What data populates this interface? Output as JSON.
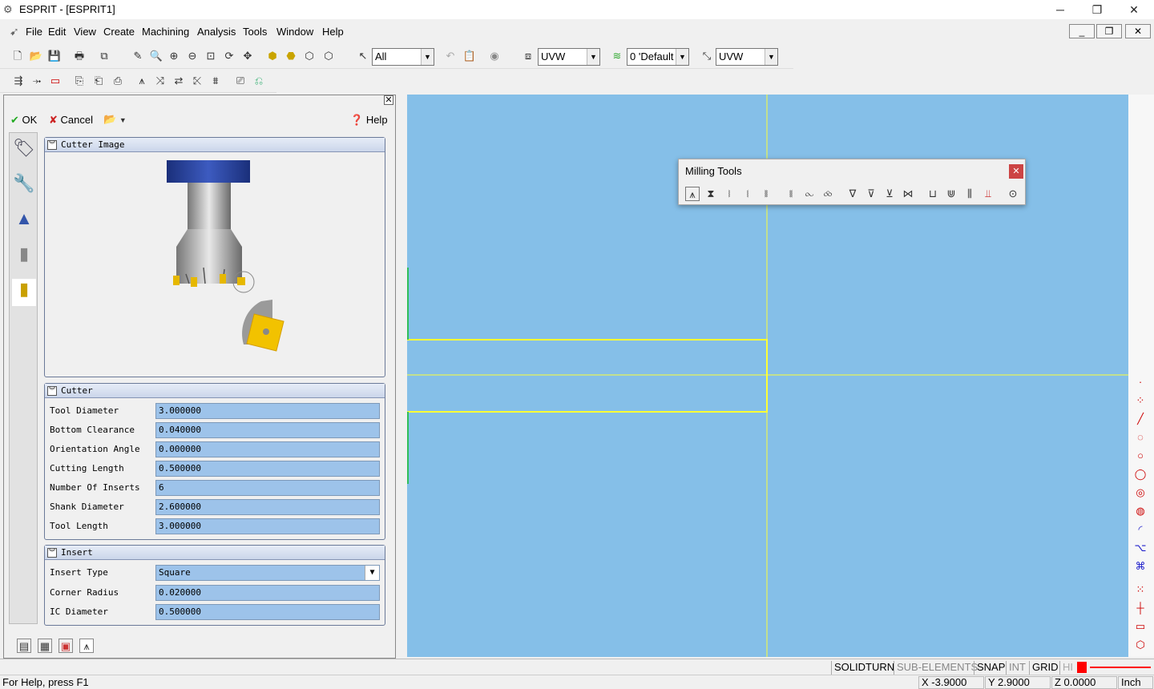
{
  "window": {
    "title": "ESPRIT - [ESPRIT1]"
  },
  "menu": [
    "File",
    "Edit",
    "View",
    "Create",
    "Machining",
    "Analysis",
    "Tools",
    "Window",
    "Help"
  ],
  "toolbar": {
    "filter_select": "All",
    "plane_select_1": "UVW",
    "layer_select": "0 'Default",
    "plane_select_2": "UVW"
  },
  "dialog": {
    "ok_label": "OK",
    "cancel_label": "Cancel",
    "help_label": "Help",
    "cutter_image_title": "Cutter Image",
    "cutter_title": "Cutter",
    "cutter_fields": [
      {
        "label": "Tool Diameter",
        "value": "3.000000"
      },
      {
        "label": "Bottom Clearance",
        "value": "0.040000"
      },
      {
        "label": "Orientation Angle",
        "value": "0.000000"
      },
      {
        "label": "Cutting Length",
        "value": "0.500000"
      },
      {
        "label": "Number Of Inserts",
        "value": "6"
      },
      {
        "label": "Shank Diameter",
        "value": "2.600000"
      },
      {
        "label": "Tool Length",
        "value": "3.000000"
      }
    ],
    "insert_title": "Insert",
    "insert_type_label": "Insert Type",
    "insert_type_value": "Square",
    "insert_fields": [
      {
        "label": "Corner Radius",
        "value": "0.020000"
      },
      {
        "label": "IC Diameter",
        "value": "0.500000"
      }
    ]
  },
  "milling_tools": {
    "title": "Milling Tools"
  },
  "status": {
    "modes": [
      "SOLIDTURN",
      "SUB-ELEMENTS",
      "SNAP",
      "INT",
      "GRID",
      "HI"
    ],
    "help_text": "For Help, press F1",
    "x": "X -3.9000",
    "y": "Y 2.9000",
    "z": "Z 0.0000",
    "units": "Inch"
  },
  "colors": {
    "viewport": "#85bfe8",
    "geometry": "#ffff33",
    "field": "#9dc3ea"
  }
}
